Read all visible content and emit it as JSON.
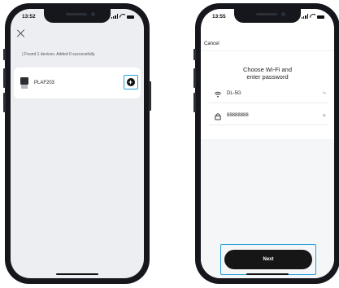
{
  "left_phone": {
    "time": "13:52",
    "found_text": ") Found 1 devices. Added 0 successfully.",
    "device": {
      "name": "PLAF203"
    },
    "add_button_glyph": "+"
  },
  "right_phone": {
    "time": "13:55",
    "cancel_label": "Cancel",
    "title": "Choose Wi-Fi and\nenter password",
    "ssid_field": {
      "value": "DL-5G",
      "trailing": "⇆"
    },
    "password_field": {
      "value": "88888888",
      "trailing": "◉"
    },
    "next_label": "Next"
  },
  "colors": {
    "highlight": "#24a0d8",
    "button": "#161616"
  }
}
